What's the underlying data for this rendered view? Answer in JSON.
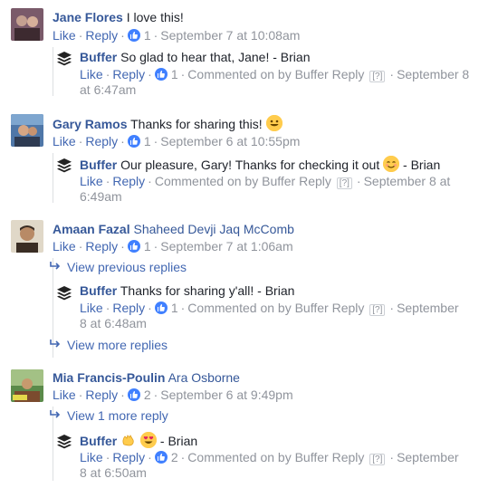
{
  "common": {
    "like": "Like",
    "reply": "Reply",
    "commented_on_by": "Commented on by",
    "question": "[?]",
    "dot": "·"
  },
  "threads": [
    {
      "author": "Jane Flores",
      "text": "I love this!",
      "likes": "1",
      "time": "September 7 at 10:08am",
      "avatar_colors": [
        "#7a5a6a",
        "#c4a090",
        "#3d2a30"
      ],
      "reply": {
        "author": "Buffer",
        "text": "So glad to hear that, Jane! - Brian",
        "likes": "1",
        "commented_by": "Buffer Reply",
        "time_a": "September 8",
        "time_b": "at 6:47am"
      }
    },
    {
      "author": "Gary Ramos",
      "text": "Thanks for sharing this!",
      "likes": "1",
      "time": "September 6 at 10:55pm",
      "avatar_colors": [
        "#4f77a8",
        "#d6a684",
        "#2e3b52"
      ],
      "reply": {
        "author": "Buffer",
        "text": "Our pleasure, Gary! Thanks for checking it out",
        "text_after": "- Brian",
        "commented_by": "Buffer Reply",
        "time_a": "September 8 at",
        "time_b": "6:49am"
      }
    },
    {
      "author": "Amaan Fazal",
      "tags": "Shaheed Devji Jaq McComb",
      "likes": "1",
      "time": "September 7 at 1:06am",
      "avatar_colors": [
        "#e0d8c8",
        "#b88a66",
        "#3a2d24"
      ],
      "view_previous": "View previous replies",
      "reply": {
        "author": "Buffer",
        "text": "Thanks for sharing y'all! - Brian",
        "likes": "1",
        "commented_by": "Buffer Reply",
        "time_a": "September",
        "time_b": "8 at 6:48am"
      },
      "view_more": "View more replies"
    },
    {
      "author": "Mia Francis-Poulin",
      "tags": "Ara Osborne",
      "likes": "2",
      "time": "September 6 at 9:49pm",
      "avatar_colors": [
        "#5b8a4a",
        "#c79a6e",
        "#7b4b2e"
      ],
      "view_previous": "View 1 more reply",
      "reply": {
        "author": "Buffer",
        "text": "- Brian",
        "likes": "2",
        "commented_by": "Buffer Reply",
        "time_a": "September",
        "time_b": "8 at 6:50am"
      }
    }
  ]
}
